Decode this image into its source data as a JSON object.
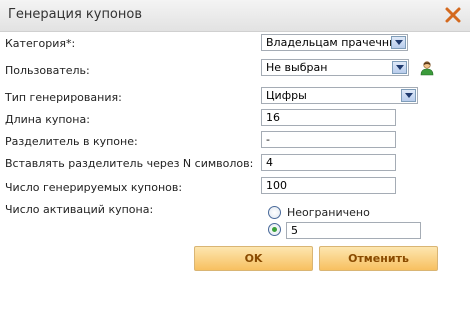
{
  "dialog": {
    "title": "Генерация купонов"
  },
  "form": {
    "category": {
      "label": "Категория*:",
      "value": "Владельцам прачечных"
    },
    "user": {
      "label": "Пользователь:",
      "value": "Не выбран"
    },
    "gen_type": {
      "label": "Тип генерирования:",
      "value": "Цифры"
    },
    "length": {
      "label": "Длина купона:",
      "value": "16"
    },
    "separator": {
      "label": "Разделитель в купоне:",
      "value": "-"
    },
    "insert_every": {
      "label": "Вставлять разделитель через N символов:",
      "value": "4"
    },
    "count": {
      "label": "Число генерируемых купонов:",
      "value": "100"
    },
    "activations": {
      "label": "Число активаций купона:",
      "option_unlimited": "Неограничено",
      "option_custom_value": "5",
      "selected": "custom"
    }
  },
  "buttons": {
    "ok": "OK",
    "cancel": "Отменить"
  },
  "colors": {
    "button_top": "#fde6b0",
    "button_bottom": "#f7c060",
    "button_text": "#8a4b00",
    "close_x": "#d4691e"
  }
}
